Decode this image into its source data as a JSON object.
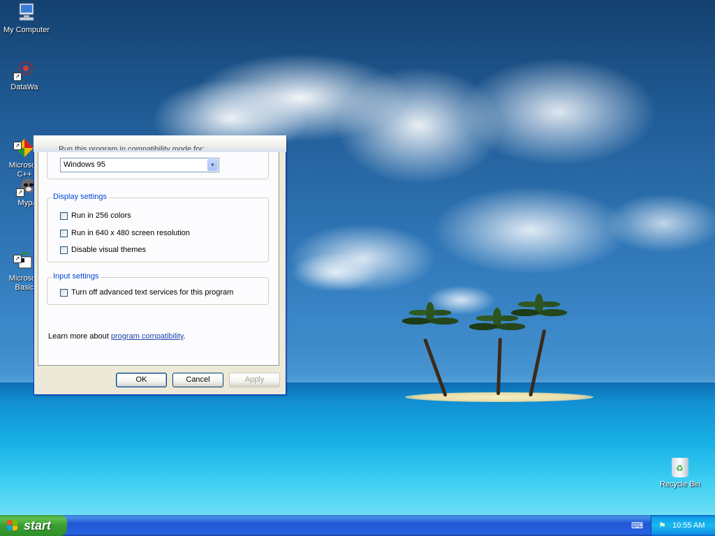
{
  "desktop": {
    "icons": [
      {
        "label": "My Computer"
      },
      {
        "label": "DataWa"
      },
      {
        "label": "Microsoft\nC++"
      },
      {
        "label": "Mypa"
      },
      {
        "label": "Microsoft\nBasic"
      }
    ],
    "recycle_bin": {
      "label": "Recycle Bin"
    }
  },
  "dialog": {
    "compat_mode_checkbox_label": "Run this program in compatibility mode for:",
    "os_select": {
      "value": "Windows 95"
    },
    "display_settings": {
      "title": "Display settings",
      "options": [
        {
          "label": "Run in 256 colors",
          "checked": false
        },
        {
          "label": "Run in 640 x 480 screen resolution",
          "checked": false
        },
        {
          "label": "Disable visual themes",
          "checked": false
        }
      ]
    },
    "input_settings": {
      "title": "Input settings",
      "options": [
        {
          "label": "Turn off advanced text services for this program",
          "checked": false
        }
      ]
    },
    "learn_more": {
      "prefix": "Learn more about ",
      "link": "program compatibility",
      "suffix": "."
    },
    "buttons": {
      "ok": "OK",
      "cancel": "Cancel",
      "apply": "Apply"
    }
  },
  "taskbar": {
    "start_label": "start",
    "clock": "10:55 AM"
  }
}
